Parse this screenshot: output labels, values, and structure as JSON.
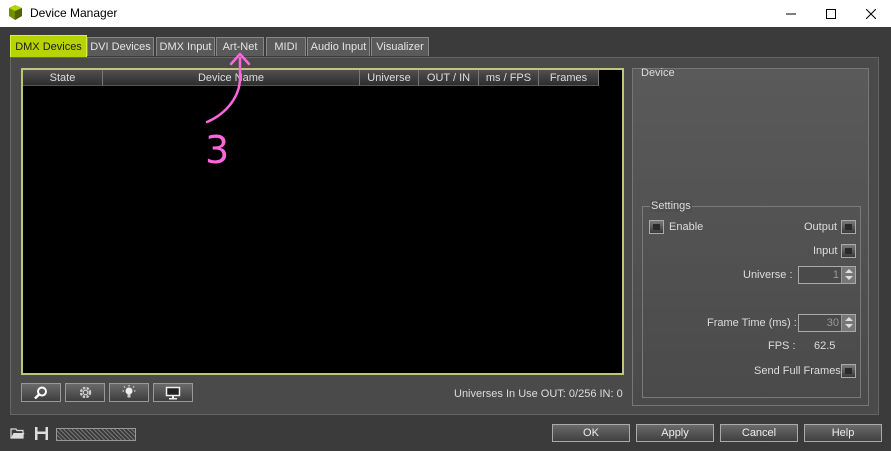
{
  "window": {
    "title": "Device Manager",
    "minimize_icon": "minimize-icon",
    "maximize_icon": "maximize-icon",
    "close_icon": "close-icon"
  },
  "tabs": [
    {
      "label": "DMX Devices",
      "active": true
    },
    {
      "label": "DVI Devices",
      "active": false
    },
    {
      "label": "DMX Input",
      "active": false
    },
    {
      "label": "Art-Net",
      "active": false
    },
    {
      "label": "MIDI",
      "active": false
    },
    {
      "label": "Audio Input",
      "active": false
    },
    {
      "label": "Visualizer",
      "active": false
    }
  ],
  "device_list": {
    "columns": [
      "State",
      "Device Name",
      "Universe",
      "OUT / IN",
      "ms / FPS",
      "Frames"
    ],
    "rows": []
  },
  "toolbar": {
    "buttons": [
      {
        "icon": "search-icon"
      },
      {
        "icon": "gear-icon"
      },
      {
        "icon": "light-bulb-icon"
      },
      {
        "icon": "monitor-icon"
      }
    ],
    "status": "Universes In Use OUT: 0/256  IN: 0"
  },
  "device_panel": {
    "title": "Device",
    "settings": {
      "title": "Settings",
      "enable_label": "Enable",
      "output_label": "Output",
      "input_label": "Input",
      "universe_label": "Universe :",
      "universe_value": "1",
      "frame_time_label": "Frame Time (ms) :",
      "frame_time_value": "30",
      "fps_label": "FPS :",
      "fps_value": "62.5",
      "send_full_frames_label": "Send Full Frames"
    }
  },
  "footer": {
    "ok_label": "OK",
    "apply_label": "Apply",
    "cancel_label": "Cancel",
    "help_label": "Help",
    "icons": [
      "open-folder-icon",
      "save-icon"
    ]
  },
  "annotation": {
    "text": "3",
    "color": "#ff66dd"
  },
  "colors": {
    "accent": "#b8d400",
    "background": "#3b3b3b",
    "list_background": "#000000"
  }
}
